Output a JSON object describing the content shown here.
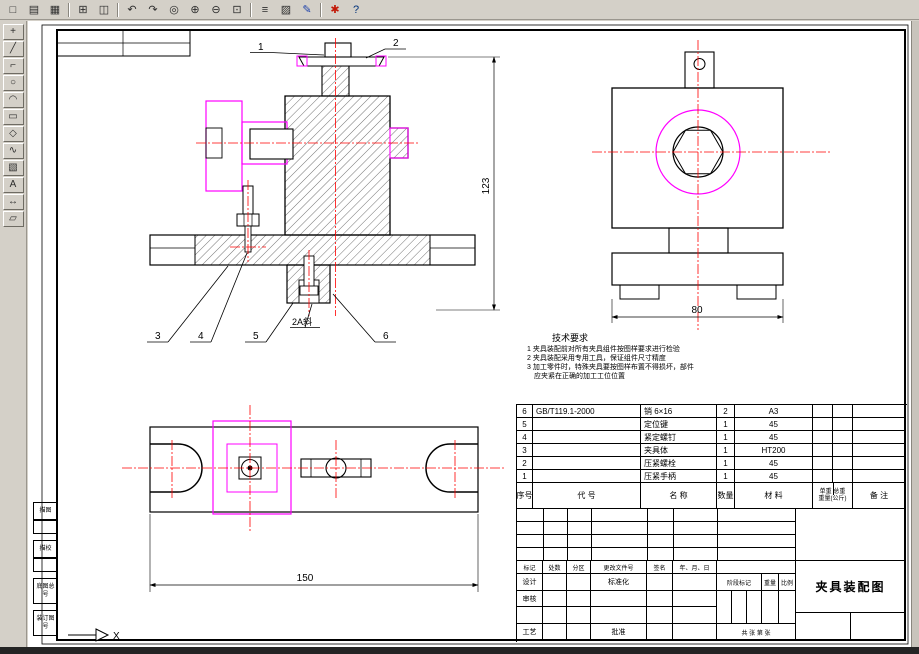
{
  "colors": {
    "chrome_bg": "#d4d0c8",
    "canvas_bg": "#ffffff",
    "centerline": "#ff0000",
    "auxiliary": "#ff00ff",
    "line": "#000000"
  },
  "toolbar": {
    "buttons": [
      {
        "name": "new-file",
        "glyph": "□"
      },
      {
        "name": "open-file",
        "glyph": "▤"
      },
      {
        "name": "save-file",
        "glyph": "▦"
      },
      {
        "sep": true
      },
      {
        "name": "print",
        "glyph": "⊞"
      },
      {
        "name": "print-preview",
        "glyph": "◫"
      },
      {
        "sep": true
      },
      {
        "name": "undo",
        "glyph": "↶"
      },
      {
        "name": "redo",
        "glyph": "↷"
      },
      {
        "name": "pan",
        "glyph": "◎"
      },
      {
        "name": "zoom-in",
        "glyph": "⊕"
      },
      {
        "name": "zoom-out",
        "glyph": "⊖"
      },
      {
        "name": "zoom-window",
        "glyph": "⊡"
      },
      {
        "sep": true
      },
      {
        "name": "layers",
        "glyph": "≡"
      },
      {
        "name": "hatch-style",
        "glyph": "▨"
      },
      {
        "name": "draw-edit",
        "glyph": "✎",
        "color": "#1a3faa"
      },
      {
        "sep": true
      },
      {
        "name": "plugin",
        "glyph": "✱",
        "color": "#c21807"
      },
      {
        "name": "help",
        "glyph": "?",
        "color": "#00327a"
      }
    ]
  },
  "sidebar": {
    "buttons": [
      {
        "name": "tool-select",
        "glyph": "+"
      },
      {
        "name": "tool-line",
        "glyph": "╱"
      },
      {
        "name": "tool-polyline",
        "glyph": "⌐"
      },
      {
        "name": "tool-circle",
        "glyph": "○"
      },
      {
        "name": "tool-arc",
        "glyph": "◠"
      },
      {
        "name": "tool-rect",
        "glyph": "▭"
      },
      {
        "name": "tool-polygon",
        "glyph": "◇"
      },
      {
        "name": "tool-spline",
        "glyph": "∿"
      },
      {
        "name": "tool-hatch",
        "glyph": "▧"
      },
      {
        "name": "tool-text",
        "glyph": "A"
      },
      {
        "name": "tool-dimension",
        "glyph": "↔"
      },
      {
        "name": "tool-erase",
        "glyph": "▱"
      }
    ]
  },
  "drawing": {
    "dims": {
      "front_height": "123",
      "side_width": "80",
      "top_width": "150"
    },
    "balloons": [
      "1",
      "2",
      "3",
      "4",
      "5",
      "6"
    ],
    "note": "2A斜",
    "ucs_label": "X",
    "tech": {
      "title": "技术要求",
      "lines": [
        "1 夹具装配前对所有夹具组件按图样要求进行检验",
        "2 夹具装配采用专用工具，保证组件尺寸精度",
        "3 加工零件时，特殊夹具要按图样布置不得损坏，部件",
        "应夹紧在正确的加工工位位置"
      ]
    }
  },
  "parts_table": {
    "headers": {
      "no": "序号",
      "code": "代  号",
      "name": "名  称",
      "qty": "数量",
      "material": "材  料",
      "weight_top": "单重 总重",
      "weight_bottom": "重量(公斤)",
      "remark": "备 注"
    },
    "rows": [
      {
        "no": "6",
        "code": "GB/T119.1-2000",
        "name": "销 6×16",
        "qty": "2",
        "material": "A3"
      },
      {
        "no": "5",
        "code": "",
        "name": "定位键",
        "qty": "1",
        "material": "45"
      },
      {
        "no": "4",
        "code": "",
        "name": "紧定螺钉",
        "qty": "1",
        "material": "45"
      },
      {
        "no": "3",
        "code": "",
        "name": "夹具体",
        "qty": "1",
        "material": "HT200"
      },
      {
        "no": "2",
        "code": "",
        "name": "压紧螺栓",
        "qty": "1",
        "material": "45"
      },
      {
        "no": "1",
        "code": "",
        "name": "压紧手柄",
        "qty": "1",
        "material": "45"
      }
    ]
  },
  "title_block": {
    "mark": "标记",
    "count": "处数",
    "zone": "分区",
    "change_no": "更改文件号",
    "sign": "签名",
    "date": "年、月、日",
    "design": "设计",
    "standardize": "标准化",
    "stage_mark": "阶段标记",
    "weight": "重量",
    "scale": "比例",
    "check": "审核",
    "craft": "工艺",
    "approve": "批准",
    "sheets": "共  张  第  张",
    "drawing_title": "夹具装配图"
  },
  "margin_labels": [
    "描图",
    "描校",
    "底图总号",
    "装订图号"
  ]
}
